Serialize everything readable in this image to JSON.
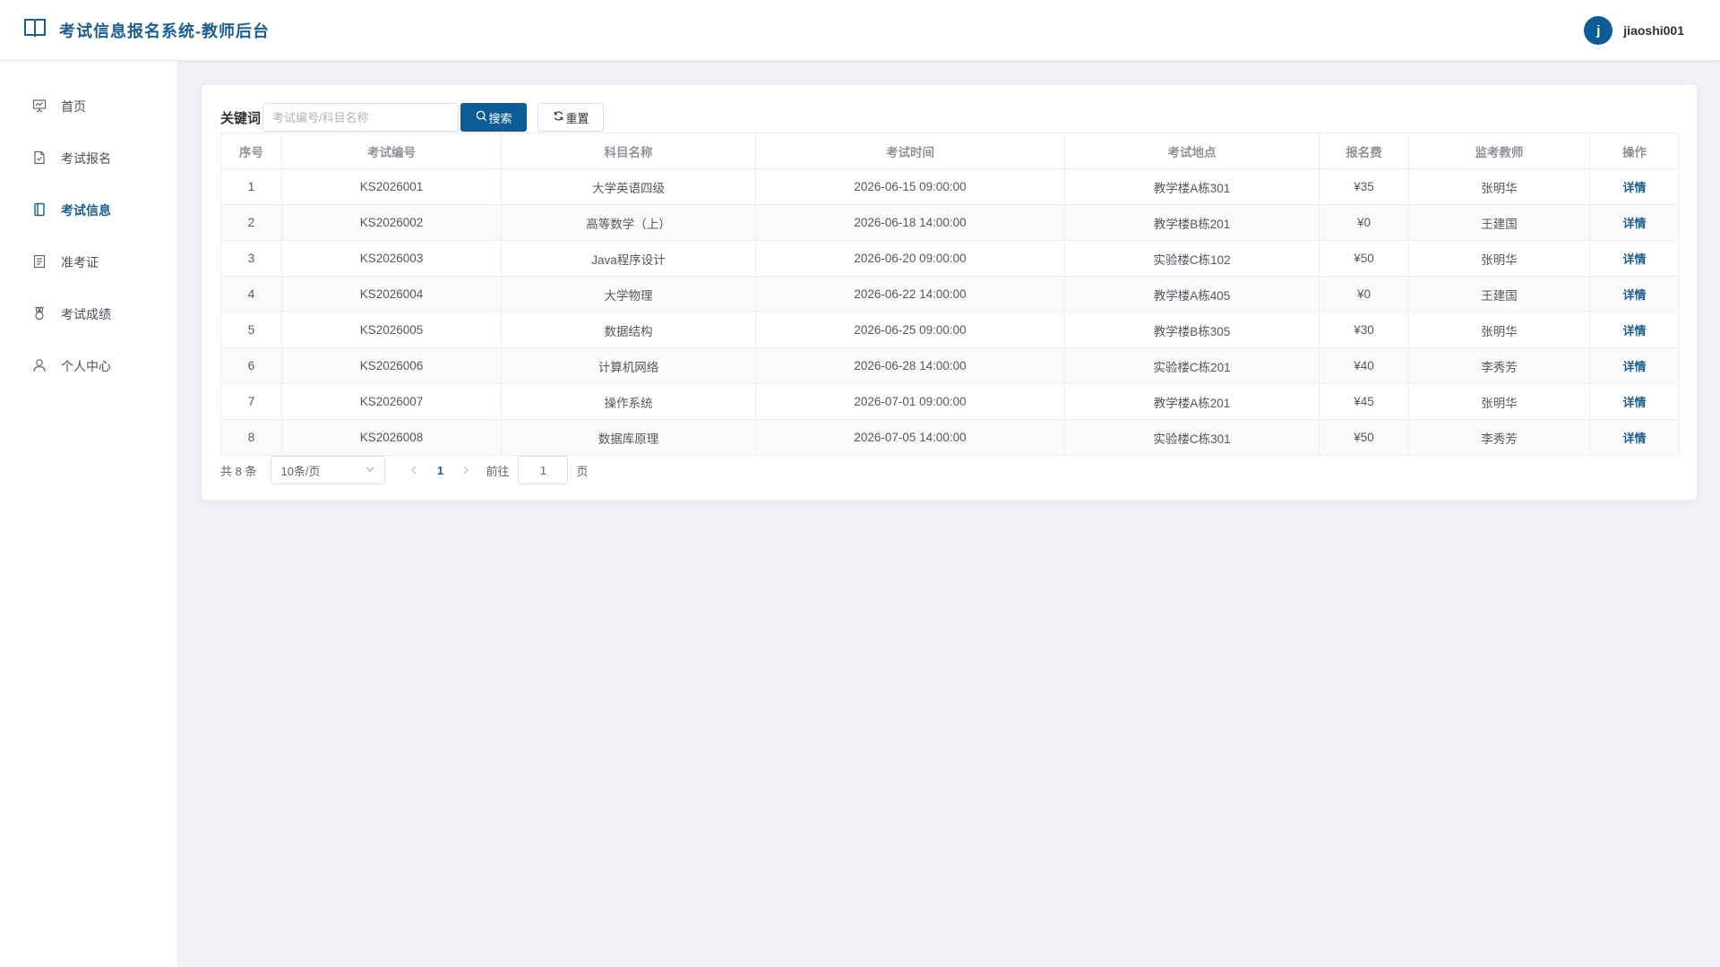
{
  "header": {
    "title": "考试信息报名系统-教师后台",
    "avatar_letter": "j",
    "username": "jiaoshi001"
  },
  "sidebar": {
    "items": [
      {
        "label": "首页",
        "icon": "presentation-icon"
      },
      {
        "label": "考试报名",
        "icon": "file-check-icon"
      },
      {
        "label": "考试信息",
        "icon": "book-icon",
        "active": true
      },
      {
        "label": "准考证",
        "icon": "document-icon"
      },
      {
        "label": "考试成绩",
        "icon": "medal-icon"
      },
      {
        "label": "个人中心",
        "icon": "user-icon"
      }
    ]
  },
  "search": {
    "label": "关键词",
    "placeholder": "考试编号/科目名称",
    "search_label": "搜索",
    "reset_label": "重置"
  },
  "table": {
    "columns": [
      "序号",
      "考试编号",
      "科目名称",
      "考试时间",
      "考试地点",
      "报名费",
      "监考教师",
      "操作"
    ],
    "rows": [
      {
        "no": "1",
        "code": "KS2026001",
        "subject": "大学英语四级",
        "time": "2026-06-15 09:00:00",
        "place": "教学楼A栋301",
        "fee": "¥35",
        "teacher": "张明华",
        "action": "详情"
      },
      {
        "no": "2",
        "code": "KS2026002",
        "subject": "高等数学（上）",
        "time": "2026-06-18 14:00:00",
        "place": "教学楼B栋201",
        "fee": "¥0",
        "teacher": "王建国",
        "action": "详情"
      },
      {
        "no": "3",
        "code": "KS2026003",
        "subject": "Java程序设计",
        "time": "2026-06-20 09:00:00",
        "place": "实验楼C栋102",
        "fee": "¥50",
        "teacher": "张明华",
        "action": "详情"
      },
      {
        "no": "4",
        "code": "KS2026004",
        "subject": "大学物理",
        "time": "2026-06-22 14:00:00",
        "place": "教学楼A栋405",
        "fee": "¥0",
        "teacher": "王建国",
        "action": "详情"
      },
      {
        "no": "5",
        "code": "KS2026005",
        "subject": "数据结构",
        "time": "2026-06-25 09:00:00",
        "place": "教学楼B栋305",
        "fee": "¥30",
        "teacher": "张明华",
        "action": "详情"
      },
      {
        "no": "6",
        "code": "KS2026006",
        "subject": "计算机网络",
        "time": "2026-06-28 14:00:00",
        "place": "实验楼C栋201",
        "fee": "¥40",
        "teacher": "李秀芳",
        "action": "详情"
      },
      {
        "no": "7",
        "code": "KS2026007",
        "subject": "操作系统",
        "time": "2026-07-01 09:00:00",
        "place": "教学楼A栋201",
        "fee": "¥45",
        "teacher": "张明华",
        "action": "详情"
      },
      {
        "no": "8",
        "code": "KS2026008",
        "subject": "数据库原理",
        "time": "2026-07-05 14:00:00",
        "place": "实验楼C栋301",
        "fee": "¥50",
        "teacher": "李秀芳",
        "action": "详情"
      }
    ]
  },
  "pagination": {
    "total_text": "共 8 条",
    "page_size": "10条/页",
    "current_page": "1",
    "goto_label": "前往",
    "goto_value": "1",
    "page_suffix": "页"
  },
  "colors": {
    "primary": "#0e5c96",
    "brand_text": "#1d5d8f",
    "background": "#f0f2f5"
  }
}
